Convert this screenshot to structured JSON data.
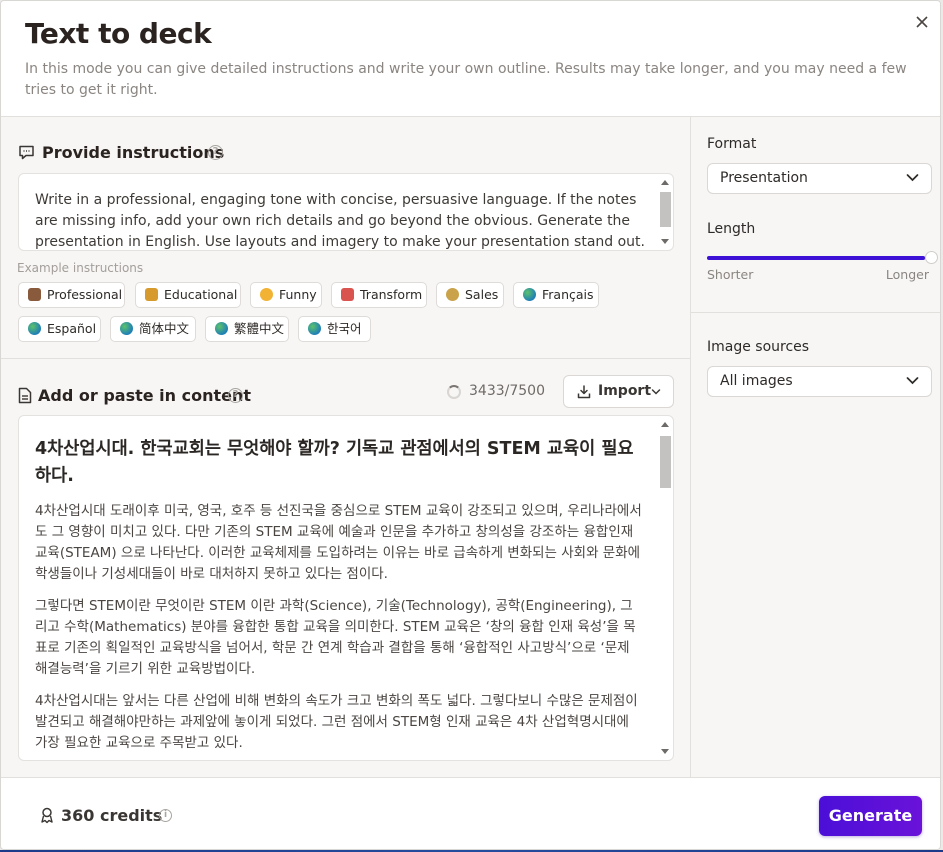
{
  "header": {
    "title": "Text to deck",
    "subtitle": "In this mode you can give detailed instructions and write your own outline. Results may take longer, and you may need a few tries to get it right."
  },
  "instructions": {
    "title": "Provide instructions",
    "text": "Write in a professional, engaging tone with concise, persuasive language. If the notes are missing info, add your own rich details and go beyond the obvious. Generate the presentation in English. Use layouts and imagery to make your presentation stand out.",
    "examples_label": "Example instructions",
    "examples": [
      {
        "label": "Professional",
        "icon": "briefcase-icon",
        "color": "#8a5a3c"
      },
      {
        "label": "Educational",
        "icon": "books-icon",
        "color": "#d69a2d"
      },
      {
        "label": "Funny",
        "icon": "laughing-face-icon",
        "color": "#f2b233"
      },
      {
        "label": "Transform",
        "icon": "magic-wand-icon",
        "color": "#d9534f"
      },
      {
        "label": "Sales",
        "icon": "money-bag-icon",
        "color": "#c9a24a"
      },
      {
        "label": "Français",
        "icon": "globe-icon",
        "color": "#2a8fc4"
      },
      {
        "label": "Español",
        "icon": "globe-icon",
        "color": "#2a8fc4"
      },
      {
        "label": "简体中文",
        "icon": "globe-icon",
        "color": "#2a8fc4"
      },
      {
        "label": "繁體中文",
        "icon": "globe-icon",
        "color": "#2a8fc4"
      },
      {
        "label": "한국어",
        "icon": "globe-icon",
        "color": "#2a8fc4"
      }
    ]
  },
  "content": {
    "title": "Add or paste in content",
    "counter": "3433/7500",
    "import_label": "Import",
    "heading": "4차산업시대. 한국교회는 무엇해야 할까? 기독교 관점에서의 STEM 교육이 필요하다.",
    "paragraphs": [
      "4차산업시대 도래이후 미국, 영국, 호주 등 선진국을 중심으로 STEM 교육이 강조되고 있으며, 우리나라에서도 그 영향이 미치고 있다. 다만 기존의 STEM 교육에 예술과 인문을 추가하고 창의성을 강조하는 융합인재교육(STEAM) 으로 나타난다. 이러한 교육체제를 도입하려는 이유는 바로 급속하게 변화되는 사회와 문화에 학생들이나 기성세대들이 바로 대처하지 못하고 있다는 점이다.",
      "그렇다면 STEM이란 무엇이란 STEM 이란 과학(Science), 기술(Technology), 공학(Engineering), 그리고 수학(Mathematics) 분야를 융합한 통합 교육을 의미한다. STEM 교육은 ‘창의 융합 인재 육성’을 목표로 기존의 획일적인 교육방식을 넘어서, 학문 간 연계 학습과 결합을 통해 ‘융합적인 사고방식’으로 ‘문제 해결능력’을 기르기 위한 교육방법이다.",
      "4차산업시대는 앞서는 다른 산업에 비해 변화의 속도가 크고 변화의 폭도 넓다. 그렇다보니 수많은 문제점이 발견되고 해결해야만하는 과제앞에 놓이게 되었다. 그런 점에서 STEM형 인재 교육은  4차 산업혁명시대에 가장 필요한 교육으로 주목받고 있다."
    ]
  },
  "settings": {
    "format_label": "Format",
    "format_value": "Presentation",
    "length_label": "Length",
    "length_min": "Shorter",
    "length_max": "Longer",
    "length_level": 1.0,
    "image_sources_label": "Image sources",
    "image_sources_value": "All images"
  },
  "footer": {
    "credits": "360 credits",
    "generate_label": "Generate"
  },
  "colors": {
    "accent": "#4b0fd8",
    "slider_fill": "#3d12d6"
  }
}
